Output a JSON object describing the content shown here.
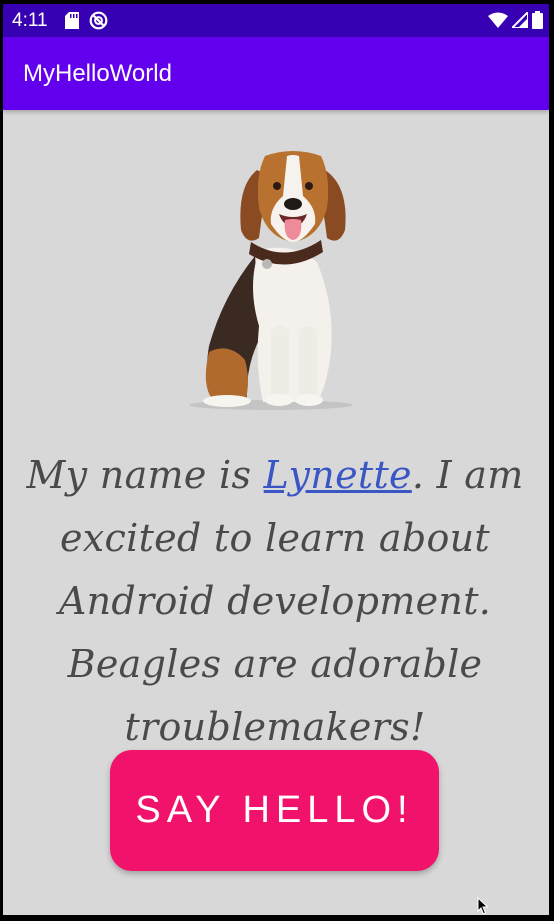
{
  "status_bar": {
    "time": "4:11",
    "left_icons": [
      "sd-card-icon",
      "do-not-disturb-icon"
    ],
    "right_icons": [
      "wifi-icon",
      "cell-signal-icon",
      "battery-icon"
    ],
    "color": "#3700b3"
  },
  "app_bar": {
    "title": "MyHelloWorld",
    "color": "#6200ee"
  },
  "main": {
    "image_icon": "beagle-dog-icon",
    "message_prefix": "My name is ",
    "name_link": "Lynette",
    "message_suffix": ". I am excited to learn about Android development. Beagles are adorable troublemakers!",
    "link_color": "#3a56c4",
    "text_color": "#4a4a4a",
    "background": "#d8d8d8"
  },
  "button": {
    "label": "SAY HELLO!",
    "color": "#f0126b"
  }
}
